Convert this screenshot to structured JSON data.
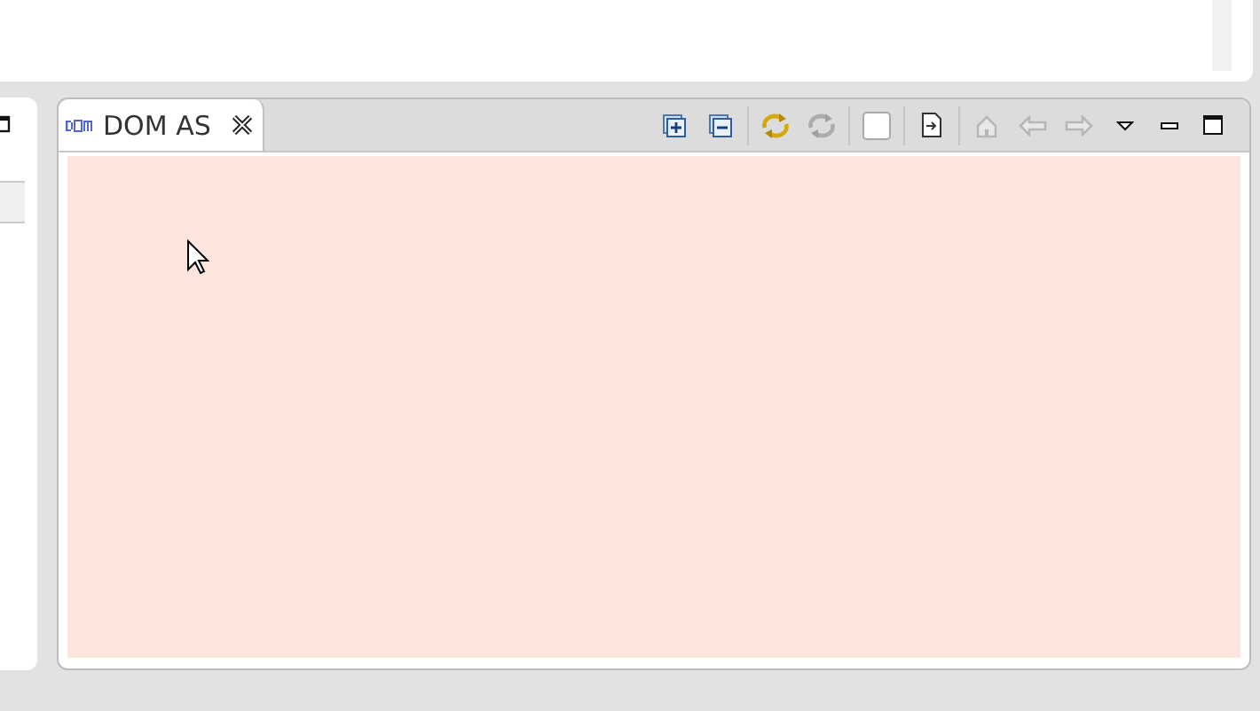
{
  "tab": {
    "label": "DOM AS",
    "selected": true
  },
  "toolbar": [
    {
      "kind": "expand",
      "disabled": false
    },
    {
      "kind": "collapse",
      "disabled": false
    },
    {
      "kind": "sep"
    },
    {
      "kind": "sync",
      "disabled": false
    },
    {
      "kind": "sync",
      "disabled": true
    },
    {
      "kind": "sep"
    },
    {
      "kind": "blank",
      "disabled": false
    },
    {
      "kind": "sep"
    },
    {
      "kind": "export",
      "disabled": false
    },
    {
      "kind": "sep"
    },
    {
      "kind": "home",
      "disabled": true
    },
    {
      "kind": "back",
      "disabled": true
    },
    {
      "kind": "forward",
      "disabled": true
    }
  ],
  "window_controls": [
    {
      "kind": "menu"
    },
    {
      "kind": "minimize"
    },
    {
      "kind": "maximize"
    }
  ]
}
